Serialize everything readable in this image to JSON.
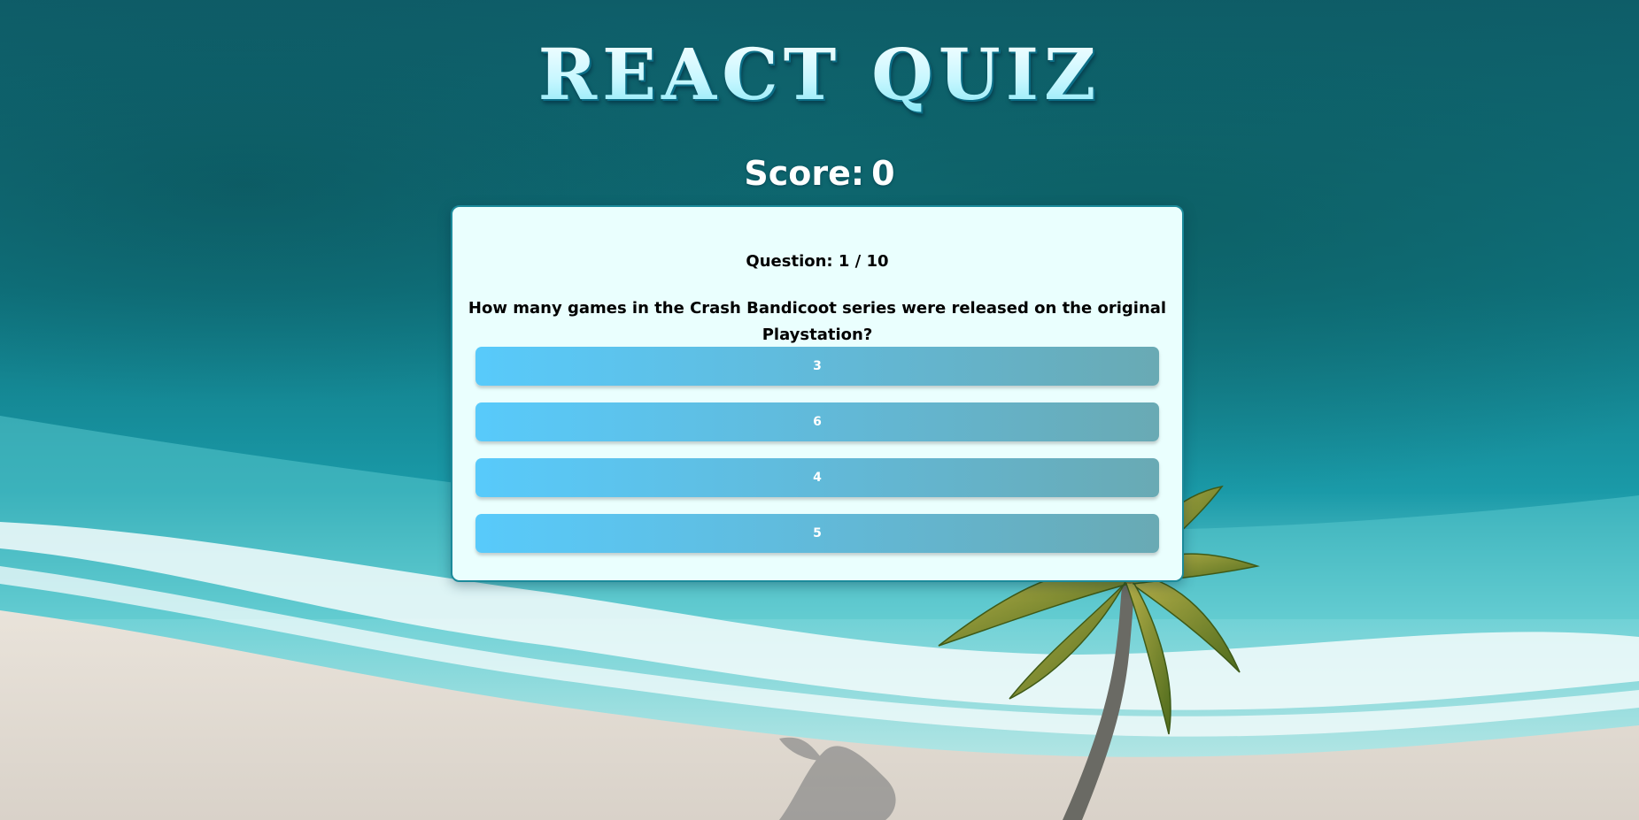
{
  "app": {
    "title": "REACT QUIZ"
  },
  "score": {
    "label": "Score:",
    "value": "0"
  },
  "quiz": {
    "question_number": "Question: 1 / 10",
    "question": "How many games in the Crash Bandicoot series were released on the original Playstation?",
    "answers": [
      {
        "label": "3"
      },
      {
        "label": "6"
      },
      {
        "label": "4"
      },
      {
        "label": "5"
      }
    ]
  },
  "colors": {
    "card_background": "#eafffe",
    "card_border": "#1b8a9a",
    "answer_gradient_start": "#58cafb",
    "answer_gradient_end": "#69aab4",
    "title_fill": "#c9f7ff"
  }
}
